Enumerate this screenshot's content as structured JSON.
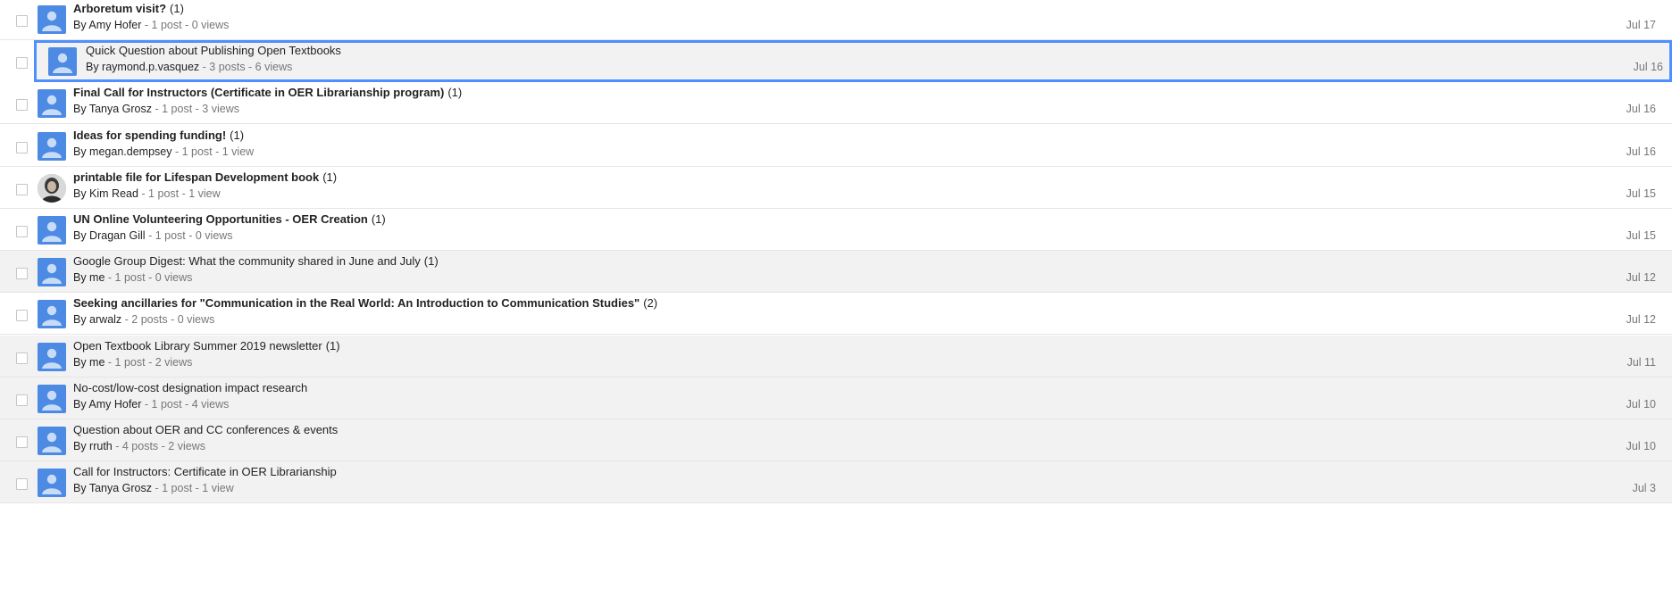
{
  "topics": [
    {
      "title": "Arboretum visit?",
      "count": "(1)",
      "by": "By Amy Hofer",
      "stats": " - 1 post - 0 views",
      "date": "Jul 17",
      "unread": true
    },
    {
      "title": "Quick Question about Publishing Open Textbooks",
      "count": "",
      "by": "By raymond.p.vasquez",
      "stats": " - 3 posts - 6 views",
      "date": "Jul 16",
      "unread": false,
      "selected": true
    },
    {
      "title": "Final Call for Instructors (Certificate in OER Librarianship program)",
      "count": "(1)",
      "by": "By Tanya Grosz",
      "stats": " - 1 post - 3 views",
      "date": "Jul 16",
      "unread": true
    },
    {
      "title": "Ideas for spending funding!",
      "count": "(1)",
      "by": "By megan.dempsey",
      "stats": " - 1 post - 1 view",
      "date": "Jul 16",
      "unread": true
    },
    {
      "title": "printable file for Lifespan Development book",
      "count": "(1)",
      "by": "By Kim Read",
      "stats": " - 1 post - 1 view",
      "date": "Jul 15",
      "unread": true,
      "photo": true
    },
    {
      "title": "UN Online Volunteering Opportunities - OER Creation",
      "count": "(1)",
      "by": "By Dragan Gill",
      "stats": " - 1 post - 0 views",
      "date": "Jul 15",
      "unread": true
    },
    {
      "title": "Google Group Digest: What the community shared in June and July",
      "count": "(1)",
      "by": "By me",
      "stats": " - 1 post - 0 views",
      "date": "Jul 12",
      "unread": false
    },
    {
      "title": "Seeking ancillaries for \"Communication in the Real World: An Introduction to Communication Studies\"",
      "count": "(2)",
      "by": "By arwalz",
      "stats": " - 2 posts - 0 views",
      "date": "Jul 12",
      "unread": true
    },
    {
      "title": "Open Textbook Library Summer 2019 newsletter",
      "count": "(1)",
      "by": "By me",
      "stats": " - 1 post - 2 views",
      "date": "Jul 11",
      "unread": false
    },
    {
      "title": "No-cost/low-cost designation impact research",
      "count": "",
      "by": "By Amy Hofer",
      "stats": " - 1 post - 4 views",
      "date": "Jul 10",
      "unread": false
    },
    {
      "title": "Question about OER and CC conferences & events",
      "count": "",
      "by": "By rruth",
      "stats": " - 4 posts - 2 views",
      "date": "Jul 10",
      "unread": false
    },
    {
      "title": "Call for Instructors: Certificate in OER Librarianship",
      "count": "",
      "by": "By Tanya Grosz",
      "stats": " - 1 post - 1 view",
      "date": "Jul 3",
      "unread": false
    }
  ],
  "colors": {
    "avatar": "#4d8ae4",
    "selection": "#4d90fe",
    "read_row": "#f2f2f2"
  },
  "icons": {
    "avatar": "default-person-icon",
    "photo": "user-photo-icon"
  }
}
